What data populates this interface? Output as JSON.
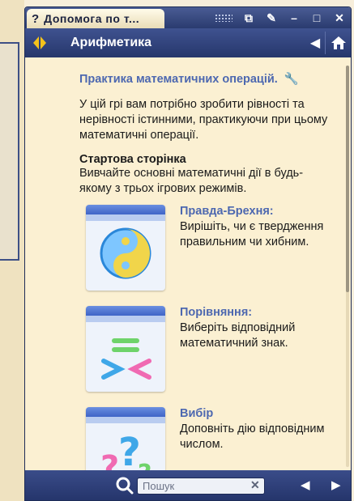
{
  "window": {
    "title": "Допомога по т...",
    "section_title": "Арифметика"
  },
  "content": {
    "heading": "Практика математичних операцій.",
    "intro": "У цій грі вам потрібно зробити рівності та нерівності істинними, практикуючи при цьому математичні операції.",
    "start_title": "Стартова сторінка",
    "start_text": "Вивчайте основні математичні дії в будь-якому з трьох ігрових режимів.",
    "modes": [
      {
        "title": "Правда-Брехня:",
        "desc": "Вирішіть, чи є твердження правильним чи хибним.",
        "icon": "yin-yang-icon"
      },
      {
        "title": "Порівняння:",
        "desc": "Виберіть відповідний математичний знак.",
        "icon": "compare-signs-icon"
      },
      {
        "title": "Вибір",
        "desc": "Доповніть дію відповідним числом.",
        "icon": "question-marks-icon"
      }
    ]
  },
  "bottom": {
    "search_placeholder": "Пошук"
  },
  "colors": {
    "accent": "#4d68b0",
    "bar": "#2a3b6f",
    "background": "#fbf0d2"
  }
}
